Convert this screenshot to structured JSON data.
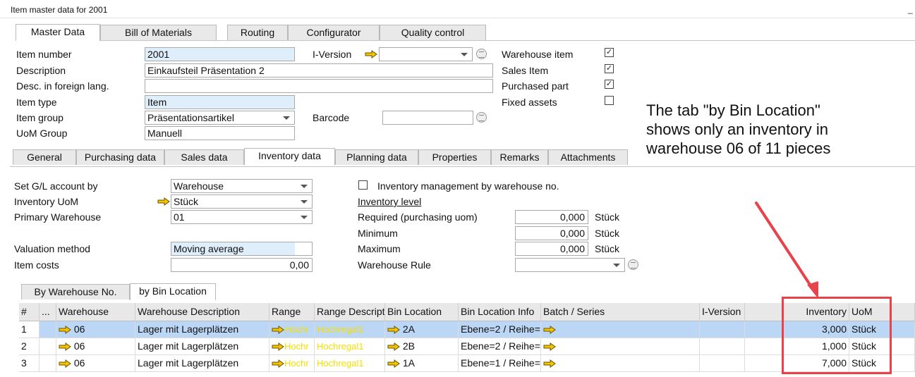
{
  "window": {
    "title": "Item master data for 2001",
    "minimize": "_"
  },
  "top_tabs": [
    "Master Data",
    "Bill of Materials",
    "Routing",
    "Configurator",
    "Quality control"
  ],
  "header": {
    "item_number_label": "Item number",
    "item_number": "2001",
    "description_label": "Description",
    "description": "Einkaufsteil Präsentation 2",
    "foreign_label": "Desc. in foreign lang.",
    "foreign": "",
    "item_type_label": "Item type",
    "item_type": "Item",
    "item_group_label": "Item group",
    "item_group": "Präsentationsartikel",
    "uom_group_label": "UoM Group",
    "uom_group": "Manuell",
    "iversion_label": "I-Version",
    "iversion": "",
    "barcode_label": "Barcode",
    "barcode": "",
    "checks": [
      {
        "label": "Warehouse item",
        "checked": true
      },
      {
        "label": "Sales Item",
        "checked": true
      },
      {
        "label": "Purchased part",
        "checked": true
      },
      {
        "label": "Fixed assets",
        "checked": false
      }
    ],
    "check_mark": "✓"
  },
  "sub_tabs": [
    "General",
    "Purchasing data",
    "Sales data",
    "Inventory data",
    "Planning data",
    "Properties",
    "Remarks",
    "Attachments"
  ],
  "inventory": {
    "gl_label": "Set G/L account by",
    "gl": "Warehouse",
    "uom_label": "Inventory UoM",
    "uom": "Stück",
    "primary_label": "Primary Warehouse",
    "primary": "01",
    "valuation_label": "Valuation method",
    "valuation": "Moving average",
    "costs_label": "Item costs",
    "costs": "0,00",
    "mgmt_label": "Inventory management by warehouse no.",
    "level_label": "Inventory level",
    "required_label": "Required (purchasing uom)",
    "required": "0,000",
    "minimum_label": "Minimum",
    "minimum": "0,000",
    "maximum_label": "Maximum",
    "maximum": "0,000",
    "unit": "Stück",
    "rule_label": "Warehouse Rule",
    "rule": ""
  },
  "grid_tabs": [
    "By Warehouse No.",
    "by Bin Location"
  ],
  "grid": {
    "columns": [
      "#",
      "...",
      "Warehouse",
      "Warehouse Description",
      "Range",
      "Range Descripti",
      "Bin Location",
      "Bin Location Info",
      "Batch / Series",
      "I-Version",
      "Inventory",
      "UoM"
    ],
    "rows": [
      {
        "n": "1",
        "wh": "06",
        "desc": "Lager mit Lagerplätzen",
        "range": "Hochr",
        "rdesc": "Hochregal1",
        "bin": "2A",
        "info": "Ebene=2 / Reihe=/",
        "inv": "3,000",
        "uom": "Stück"
      },
      {
        "n": "2",
        "wh": "06",
        "desc": "Lager mit Lagerplätzen",
        "range": "Hochr",
        "rdesc": "Hochregal1",
        "bin": "2B",
        "info": "Ebene=2 / Reihe=I",
        "inv": "1,000",
        "uom": "Stück"
      },
      {
        "n": "3",
        "wh": "06",
        "desc": "Lager mit Lagerplätzen",
        "range": "Hochr",
        "rdesc": "Hochregal1",
        "bin": "1A",
        "info": "Ebene=1 / Reihe=/",
        "inv": "7,000",
        "uom": "Stück"
      }
    ]
  },
  "annotation": "The tab \"by Bin Location\"\nshows only an inventory in\nwarehouse 06 of 11 pieces",
  "colors": {
    "arrow_yellow": "#f5c400",
    "annot_red": "#e8424a",
    "selected_row": "#bcd6f5",
    "field_blue": "#dfeefb"
  }
}
